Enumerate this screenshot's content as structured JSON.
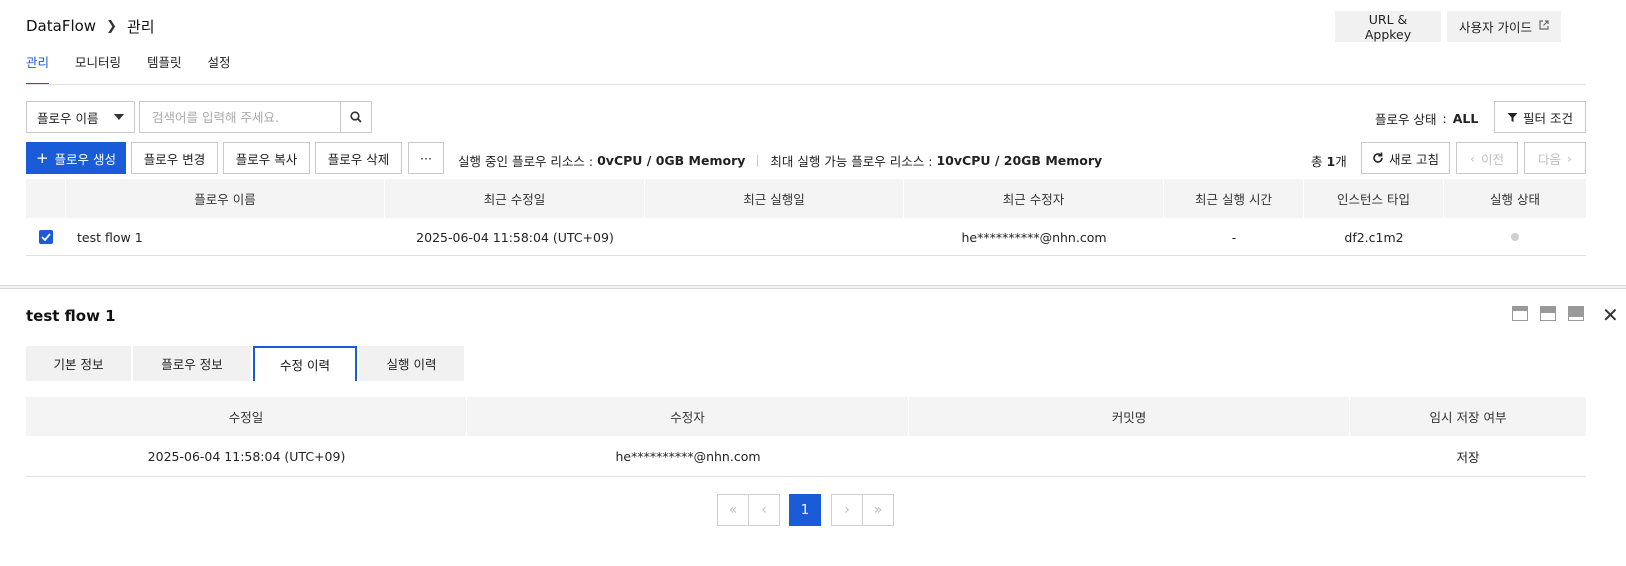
{
  "header": {
    "app_name": "DataFlow",
    "page_name": "관리",
    "url_appkey_label": "URL & Appkey",
    "user_guide_label": "사용자 가이드"
  },
  "tabs": [
    {
      "label": "관리",
      "active": true
    },
    {
      "label": "모니터링",
      "active": false
    },
    {
      "label": "템플릿",
      "active": false
    },
    {
      "label": "설정",
      "active": false
    }
  ],
  "filter": {
    "select_value": "플로우 이름",
    "search_placeholder": "검색어를 입력해 주세요.",
    "status_label": "플로우 상태",
    "status_sep": ":",
    "status_value": "ALL",
    "filter_button": "필터 조건"
  },
  "actions": {
    "create": "플로우 생성",
    "edit": "플로우 변경",
    "copy": "플로우 복사",
    "delete": "플로우 삭제",
    "more": "···",
    "running_label": "실행 중인 플로우 리소스 :",
    "running_value": "0vCPU / 0GB Memory",
    "max_label": "최대 실행 가능 플로우 리소스 :",
    "max_value": "10vCPU / 20GB Memory",
    "total_prefix": "총",
    "total_count": "1",
    "total_suffix": "개",
    "refresh": "새로 고침",
    "prev": "이전",
    "next": "다음"
  },
  "flow_table": {
    "columns": [
      "플로우 이름",
      "최근 수정일",
      "최근 실행일",
      "최근 수정자",
      "최근 실행 시간",
      "인스턴스 타입",
      "실행 상태"
    ],
    "rows": [
      {
        "checked": true,
        "name": "test flow 1",
        "modified": "2025-06-04 11:58:04 (UTC+09)",
        "last_run": "",
        "modifier": "he**********@nhn.com",
        "run_time": "-",
        "instance_type": "df2.c1m2",
        "status": "idle"
      }
    ]
  },
  "detail": {
    "title": "test flow 1",
    "tabs": [
      {
        "label": "기본 정보",
        "active": false
      },
      {
        "label": "플로우 정보",
        "active": false
      },
      {
        "label": "수정 이력",
        "active": true
      },
      {
        "label": "실행 이력",
        "active": false
      }
    ],
    "history_table": {
      "columns": [
        "수정일",
        "수정자",
        "커밋명",
        "임시 저장 여부"
      ],
      "rows": [
        {
          "date": "2025-06-04 11:58:04 (UTC+09)",
          "editor": "he**********@nhn.com",
          "commit": "",
          "temp_saved": "저장"
        }
      ]
    },
    "pagination": {
      "current": "1"
    }
  },
  "colors": {
    "accent": "#1a5bd8",
    "header_bg": "#f4f4f4",
    "button_bg": "#f1f1f1"
  }
}
